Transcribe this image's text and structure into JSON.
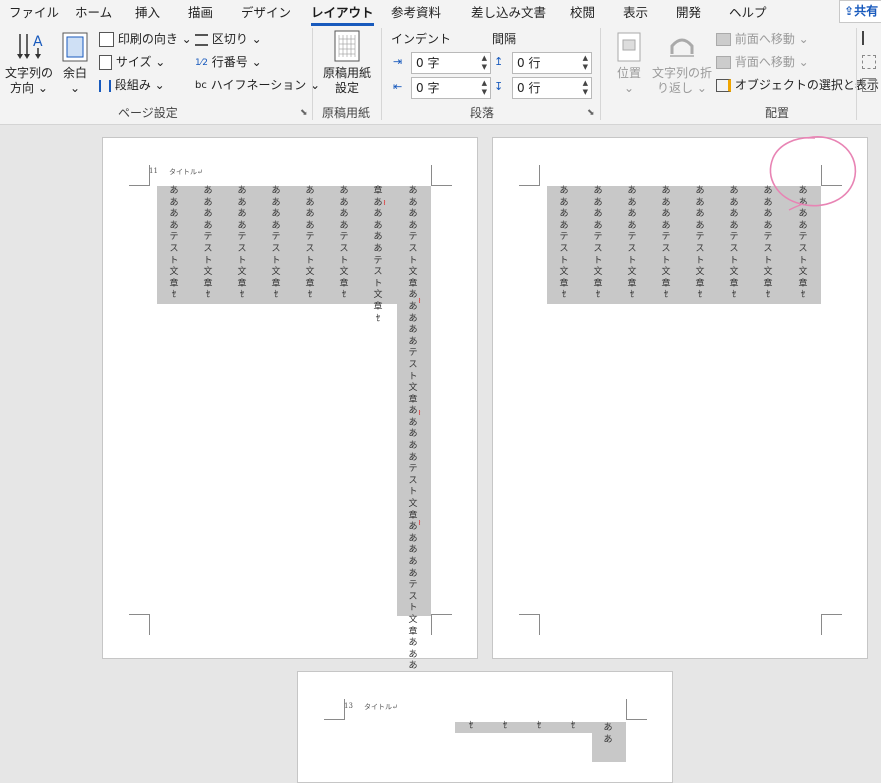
{
  "tabs": [
    "ファイル",
    "ホーム",
    "挿入",
    "描画",
    "デザイン",
    "レイアウト",
    "参考資料",
    "差し込み文書",
    "校閲",
    "表示",
    "開発",
    "ヘルプ"
  ],
  "active_tab": "レイアウト",
  "share_label": "共有",
  "page_setup": {
    "text_direction_line1": "文字列の",
    "text_direction_line2": "方向",
    "margins": "余白",
    "orientation": "印刷の向き",
    "size": "サイズ",
    "columns": "段組み",
    "breaks": "区切り",
    "line_numbers": "行番号",
    "hyphenation": "ハイフネーション",
    "group_label": "ページ設定"
  },
  "genko": {
    "btn_line1": "原稿用紙",
    "btn_line2": "設定",
    "group_label": "原稿用紙"
  },
  "paragraph": {
    "indent_label": "インデント",
    "spacing_label": "間隔",
    "indent_left": "0 字",
    "indent_right": "0 字",
    "spacing_before": "0 行",
    "spacing_after": "0 行",
    "group_label": "段落"
  },
  "arrange": {
    "position": "位置",
    "wrap_line1": "文字列の折",
    "wrap_line2": "り返し",
    "bring_forward": "前面へ移動",
    "send_backward": "背面へ移動",
    "selection_pane": "オブジェクトの選択と表示",
    "group_label": "配置"
  },
  "document": {
    "page1_header": "タイトル↵",
    "page1_linenum": "11",
    "page3_header": "タイトル↵",
    "page3_linenum": "13",
    "col_text_long": "ああああテスト文章ｾ",
    "col_text_p1c7": "章あああああテスト文章ｾ",
    "col_text_p1c8": "ああああテスト文章あああああテスト文章あああああテスト文章あああああテスト文章あああああテスト文",
    "page3_tail": "ｾ",
    "page3_col": "ああ"
  },
  "colors": {
    "accent": "#185abd",
    "selection": "#c8c8c8",
    "annotation": "#e884b4"
  }
}
